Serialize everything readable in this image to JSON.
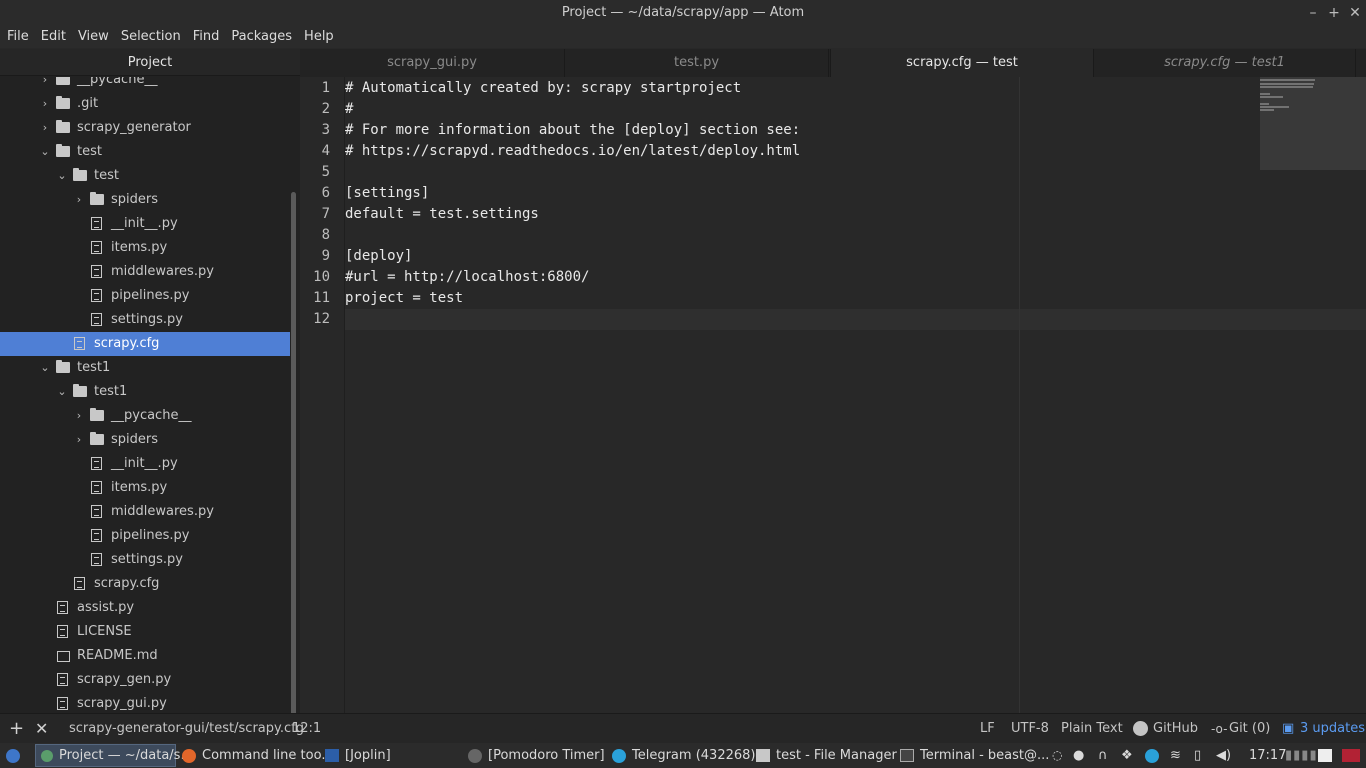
{
  "window": {
    "title": "Project — ~/data/scrapy/app — Atom"
  },
  "menu": [
    "File",
    "Edit",
    "View",
    "Selection",
    "Find",
    "Packages",
    "Help"
  ],
  "sidebar": {
    "header": "Project",
    "items": [
      {
        "label": "__pycache__",
        "type": "folder",
        "depth": 1,
        "state": "collapsed"
      },
      {
        "label": ".git",
        "type": "folder",
        "depth": 1,
        "state": "collapsed"
      },
      {
        "label": "scrapy_generator",
        "type": "folder",
        "depth": 1,
        "state": "collapsed"
      },
      {
        "label": "test",
        "type": "folder",
        "depth": 1,
        "state": "expanded"
      },
      {
        "label": "test",
        "type": "folder",
        "depth": 2,
        "state": "expanded"
      },
      {
        "label": "spiders",
        "type": "folder",
        "depth": 3,
        "state": "collapsed"
      },
      {
        "label": "__init__.py",
        "type": "file",
        "depth": 3
      },
      {
        "label": "items.py",
        "type": "file",
        "depth": 3
      },
      {
        "label": "middlewares.py",
        "type": "file",
        "depth": 3
      },
      {
        "label": "pipelines.py",
        "type": "file",
        "depth": 3
      },
      {
        "label": "settings.py",
        "type": "file",
        "depth": 3
      },
      {
        "label": "scrapy.cfg",
        "type": "file",
        "depth": 2,
        "selected": true
      },
      {
        "label": "test1",
        "type": "folder",
        "depth": 1,
        "state": "expanded"
      },
      {
        "label": "test1",
        "type": "folder",
        "depth": 2,
        "state": "expanded"
      },
      {
        "label": "__pycache__",
        "type": "folder",
        "depth": 3,
        "state": "collapsed"
      },
      {
        "label": "spiders",
        "type": "folder",
        "depth": 3,
        "state": "collapsed"
      },
      {
        "label": "__init__.py",
        "type": "file",
        "depth": 3
      },
      {
        "label": "items.py",
        "type": "file",
        "depth": 3
      },
      {
        "label": "middlewares.py",
        "type": "file",
        "depth": 3
      },
      {
        "label": "pipelines.py",
        "type": "file",
        "depth": 3
      },
      {
        "label": "settings.py",
        "type": "file",
        "depth": 3
      },
      {
        "label": "scrapy.cfg",
        "type": "file",
        "depth": 2
      },
      {
        "label": "assist.py",
        "type": "file",
        "depth": 1
      },
      {
        "label": "LICENSE",
        "type": "file",
        "depth": 1
      },
      {
        "label": "README.md",
        "type": "book",
        "depth": 1
      },
      {
        "label": "scrapy_gen.py",
        "type": "file",
        "depth": 1
      },
      {
        "label": "scrapy_gui.py",
        "type": "file",
        "depth": 1
      }
    ]
  },
  "tabs": [
    {
      "label": "scrapy_gui.py",
      "active": false
    },
    {
      "label": "test.py",
      "active": false
    },
    {
      "label": "scrapy.cfg — test",
      "active": true
    },
    {
      "label": "scrapy.cfg — test1",
      "active": false,
      "pending": true
    }
  ],
  "editor": {
    "lines": [
      "# Automatically created by: scrapy startproject",
      "#",
      "# For more information about the [deploy] section see:",
      "# https://scrapyd.readthedocs.io/en/latest/deploy.html",
      "",
      "[settings]",
      "default = test.settings",
      "",
      "[deploy]",
      "#url = http://localhost:6800/",
      "project = test",
      ""
    ],
    "line_numbers": [
      "1",
      "2",
      "3",
      "4",
      "5",
      "6",
      "7",
      "8",
      "9",
      "10",
      "11",
      "12"
    ],
    "cursor_line": 12
  },
  "statusbar": {
    "path": "scrapy-generator-gui/test/scrapy.cfg",
    "cursor": "12:1",
    "line_ending": "LF",
    "encoding": "UTF-8",
    "grammar": "Plain Text",
    "github": "GitHub",
    "git": "Git (0)",
    "updates": "3 updates"
  },
  "taskbar": {
    "apps": [
      "Project — ~/data/s...",
      "Command line too...",
      "[Joplin]",
      "[Pomodoro Timer]",
      "Telegram (432268)",
      "test - File Manager",
      "Terminal - beast@..."
    ],
    "clock": "17:17"
  }
}
